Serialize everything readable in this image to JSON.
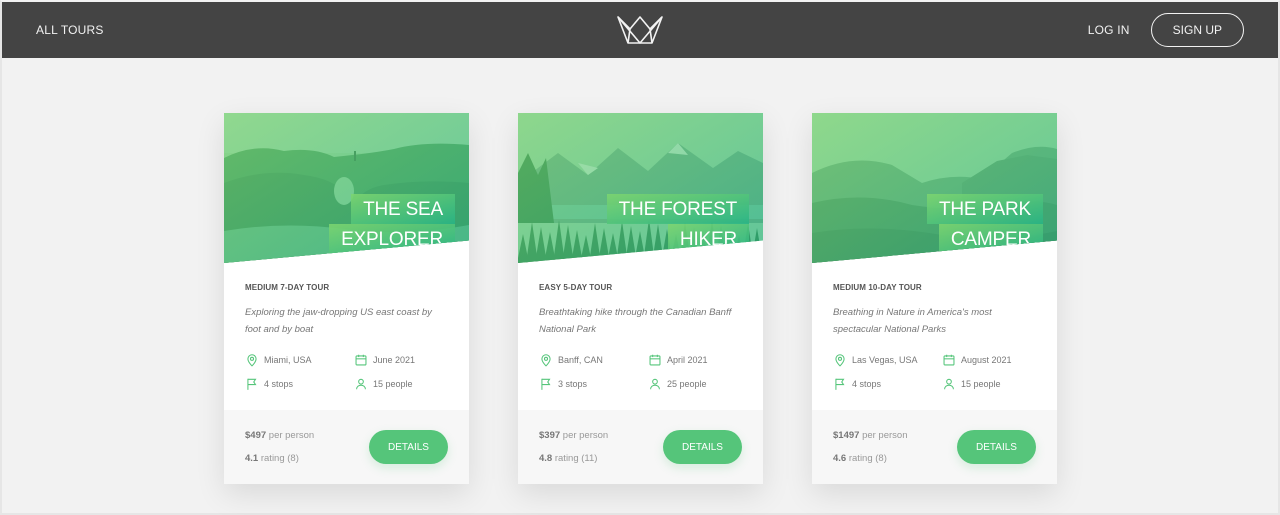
{
  "header": {
    "all_tours": "All tours",
    "logo": "logo-icon",
    "login": "Log in",
    "signup": "Sign up"
  },
  "colors": {
    "accent": "#55c57a",
    "header_bg": "#444444",
    "page_bg": "#f2f2f2"
  },
  "tours": [
    {
      "title_line1": "The Sea",
      "title_line2": "Explorer",
      "subheading": "Medium 7-day tour",
      "summary": "Exploring the jaw-dropping US east coast by foot and by boat",
      "location": "Miami, USA",
      "date": "June 2021",
      "stops": "4 stops",
      "people": "15 people",
      "price": "$497",
      "price_label": "per person",
      "rating": "4.1",
      "rating_label": "rating (8)",
      "button": "Details",
      "scene": "sea"
    },
    {
      "title_line1": "The Forest",
      "title_line2": "Hiker",
      "subheading": "Easy 5-day tour",
      "summary": "Breathtaking hike through the Canadian Banff National Park",
      "location": "Banff, CAN",
      "date": "April 2021",
      "stops": "3 stops",
      "people": "25 people",
      "price": "$397",
      "price_label": "per person",
      "rating": "4.8",
      "rating_label": "rating (11)",
      "button": "Details",
      "scene": "forest"
    },
    {
      "title_line1": "The Park",
      "title_line2": "Camper",
      "subheading": "Medium 10-day tour",
      "summary": "Breathing in Nature in America's most spectacular National Parks",
      "location": "Las Vegas, USA",
      "date": "August 2021",
      "stops": "4 stops",
      "people": "15 people",
      "price": "$1497",
      "price_label": "per person",
      "rating": "4.6",
      "rating_label": "rating (8)",
      "button": "Details",
      "scene": "park"
    }
  ],
  "icons": {
    "location": "map-pin-icon",
    "date": "calendar-icon",
    "stops": "flag-icon",
    "people": "user-icon"
  }
}
